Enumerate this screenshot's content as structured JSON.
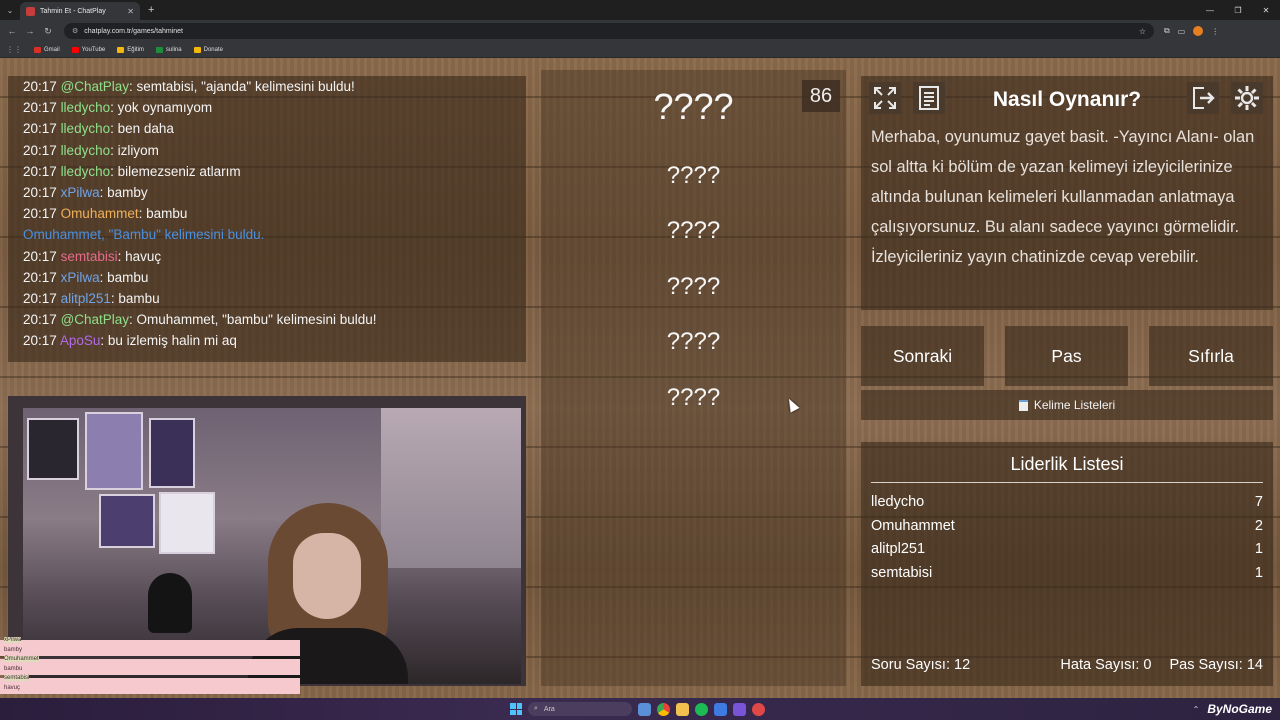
{
  "browser": {
    "tab_title": "Tahmin Et - ChatPlay",
    "url": "chatplay.com.tr/games/tahminet",
    "bookmarks": [
      {
        "label": "Gmail",
        "color": "#d93025"
      },
      {
        "label": "YouTube",
        "color": "#ff0000"
      },
      {
        "label": "Eğitim",
        "color": "#f2b90c"
      },
      {
        "label": "sulina",
        "color": "#1e8e3e"
      },
      {
        "label": "Donate",
        "color": "#f2b90c"
      }
    ]
  },
  "chat": {
    "lines": [
      {
        "time": "20:17",
        "user": "@ChatPlay",
        "user_color": "#8ee08b",
        "text": ": semtabisi, \"ajanda\" kelimesini buldu!"
      },
      {
        "time": "20:17",
        "user": "lledycho",
        "user_color": "#8ee08b",
        "text": ": yok oynamıyom"
      },
      {
        "time": "20:17",
        "user": "lledycho",
        "user_color": "#8ee08b",
        "text": ": ben daha"
      },
      {
        "time": "20:17",
        "user": "lledycho",
        "user_color": "#8ee08b",
        "text": ": izliyom"
      },
      {
        "time": "20:17",
        "user": "lledycho",
        "user_color": "#8ee08b",
        "text": ": bilemezseniz atlarım"
      },
      {
        "time": "20:17",
        "user": "xPilwa",
        "user_color": "#6fa3e8",
        "text": ": bamby"
      },
      {
        "time": "20:17",
        "user": "Omuhammet",
        "user_color": "#f0b05a",
        "text": ": bambu"
      },
      {
        "system": "Omuhammet, \"Bambu\" kelimesini buldu."
      },
      {
        "time": "20:17",
        "user": "semtabisi",
        "user_color": "#e56b8b",
        "text": ": havuç"
      },
      {
        "time": "20:17",
        "user": "xPilwa",
        "user_color": "#6fa3e8",
        "text": ": bambu"
      },
      {
        "time": "20:17",
        "user": "alitpl251",
        "user_color": "#6fa3e8",
        "text": ": bambu"
      },
      {
        "time": "20:17",
        "user": "@ChatPlay",
        "user_color": "#8ee08b",
        "text": ": Omuhammet, \"bambu\" kelimesini buldu!"
      },
      {
        "time": "20:17",
        "user": "ApoSu",
        "user_color": "#b06ae8",
        "text": ": bu izlemiş halin mi aq"
      }
    ]
  },
  "overlay": {
    "messages": [
      {
        "user": "xPilwa",
        "text": "bamby"
      },
      {
        "user": "Omuhammet",
        "text": "bambu"
      },
      {
        "user": "semtabisi",
        "text": "havuç"
      }
    ]
  },
  "game": {
    "timer": "86",
    "main_word": "????",
    "forbidden_words": [
      "????",
      "????",
      "????",
      "????",
      "????"
    ]
  },
  "how_to": {
    "title": "Nasıl Oynanır?",
    "text": "Merhaba, oyunumuz gayet basit. -Yayıncı Alanı- olan sol altta ki bölüm de yazan kelimeyi izleyicilerinize altında bulunan kelimeleri kullanmadan anlatmaya çalışıyorsunuz. Bu alanı sadece yayıncı görmelidir. İzleyicileriniz yayın chatinizde cevap verebilir."
  },
  "actions": {
    "next": "Sonraki",
    "pass": "Pas",
    "reset": "Sıfırla",
    "word_lists": "Kelime Listeleri"
  },
  "leaderboard": {
    "title": "Liderlik Listesi",
    "rows": [
      {
        "name": "lledycho",
        "score": "7"
      },
      {
        "name": "Omuhammet",
        "score": "2"
      },
      {
        "name": "alitpl251",
        "score": "1"
      },
      {
        "name": "semtabisi",
        "score": "1"
      }
    ],
    "question_count": "Soru Sayısı: 12",
    "error_count": "Hata Sayısı: 0",
    "pass_count": "Pas Sayısı: 14"
  },
  "taskbar": {
    "search_placeholder": "Ara",
    "watermark": "ByNoGame"
  }
}
